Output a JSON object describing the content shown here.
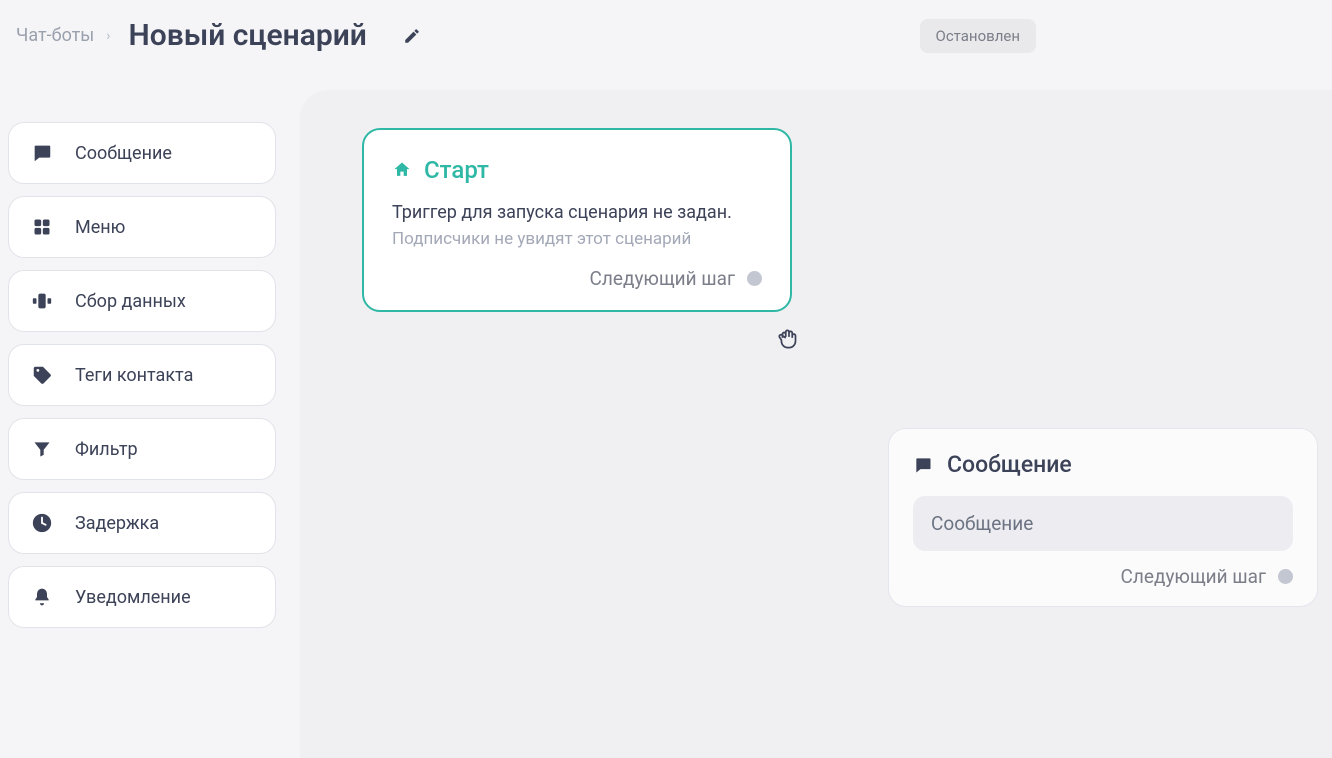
{
  "header": {
    "breadcrumb_root": "Чат-боты",
    "title": "Новый сценарий",
    "status": "Остановлен"
  },
  "sidebar": {
    "items": [
      {
        "label": "Сообщение",
        "icon": "chat-icon"
      },
      {
        "label": "Меню",
        "icon": "grid-icon"
      },
      {
        "label": "Сбор данных",
        "icon": "form-icon"
      },
      {
        "label": "Теги контакта",
        "icon": "tag-icon"
      },
      {
        "label": "Фильтр",
        "icon": "filter-icon"
      },
      {
        "label": "Задержка",
        "icon": "clock-icon"
      },
      {
        "label": "Уведомление",
        "icon": "bell-icon"
      }
    ]
  },
  "canvas": {
    "start_node": {
      "title": "Старт",
      "message": "Триггер для запуска сценария не задан.",
      "hint": "Подписчики не увидят этот сценарий",
      "next_label": "Следующий шаг"
    },
    "message_node": {
      "title": "Сообщение",
      "body_placeholder": "Сообщение",
      "next_label": "Следующий шаг"
    }
  }
}
